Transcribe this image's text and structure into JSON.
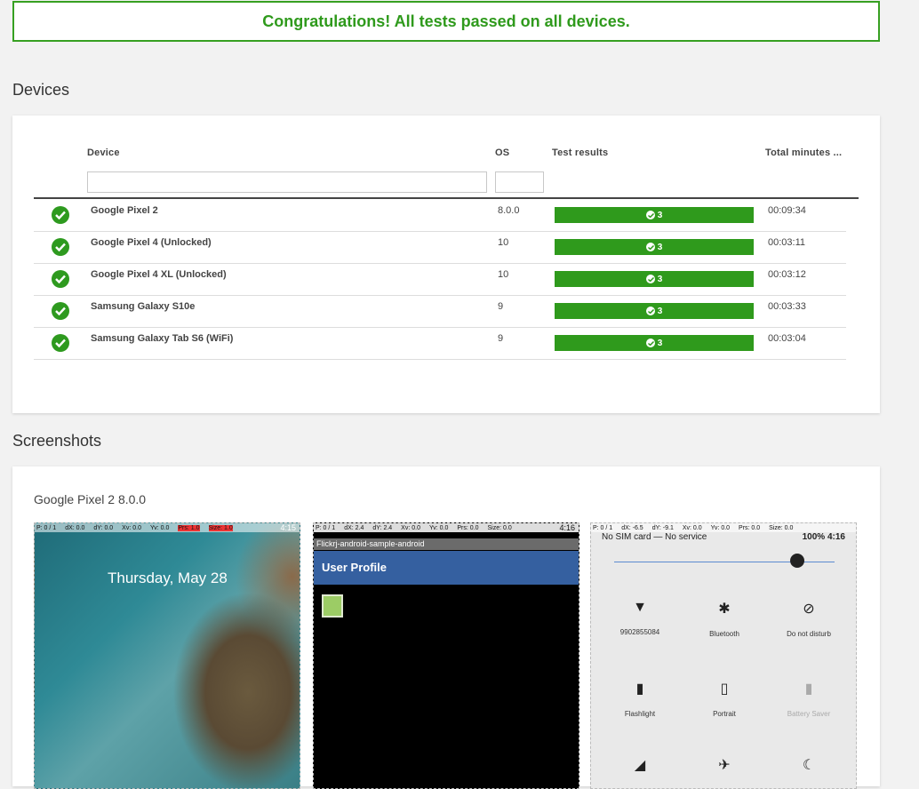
{
  "banner": "Congratulations! All tests passed on all devices.",
  "devices_section": {
    "title": "Devices",
    "columns": {
      "device": "Device",
      "os": "OS",
      "results": "Test results",
      "minutes": "Total minutes ..."
    },
    "rows": [
      {
        "device": "Google Pixel 2",
        "os": "8.0.0",
        "passed": "3",
        "minutes": "00:09:34"
      },
      {
        "device": "Google Pixel 4 (Unlocked)",
        "os": "10",
        "passed": "3",
        "minutes": "00:03:11"
      },
      {
        "device": "Google Pixel 4 XL (Unlocked)",
        "os": "10",
        "passed": "3",
        "minutes": "00:03:12"
      },
      {
        "device": "Samsung Galaxy S10e",
        "os": "9",
        "passed": "3",
        "minutes": "00:03:33"
      },
      {
        "device": "Samsung Galaxy Tab S6 (WiFi)",
        "os": "9",
        "passed": "3",
        "minutes": "00:03:04"
      }
    ]
  },
  "screenshots_section": {
    "title": "Screenshots",
    "group_title": "Google Pixel 2 8.0.0",
    "shot1": {
      "status": [
        "P: 0 / 1",
        "dX: 0.0",
        "dY: 0.0",
        "Xv: 0.0",
        "Yv: 0.0",
        "Prs: 1.0",
        "Size: 1.0"
      ],
      "date": "Thursday, May 28",
      "time": "4:15"
    },
    "shot2": {
      "status": [
        "P: 0 / 1",
        "dX: 2.4",
        "dY: 2.4",
        "Xv: 0.0",
        "Yv: 0.0",
        "Prs: 0.0",
        "Size: 0.0"
      ],
      "app_name": "Flickrj-android-sample-android",
      "screen_title": "User Profile",
      "time": "4:16"
    },
    "shot3": {
      "status": [
        "P: 0 / 1",
        "dX: -6.5",
        "dY: -9.1",
        "Xv: 0.0",
        "Yv: 0.0",
        "Prs: 0.0",
        "Size: 0.0"
      ],
      "sim": "No SIM card — No service",
      "battery": "100% 4:16",
      "tiles": [
        "9902855084",
        "Bluetooth",
        "Do not disturb",
        "Flashlight",
        "Portrait",
        "Battery Saver"
      ]
    }
  }
}
